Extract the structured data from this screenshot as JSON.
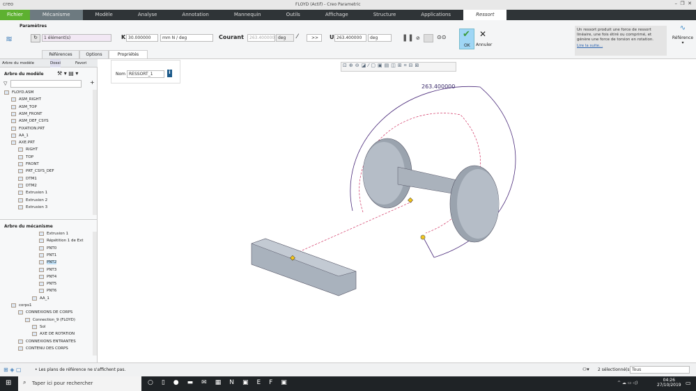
{
  "app": {
    "logo": "creo",
    "title": "FLOYD (Actif) - Creo Parametric"
  },
  "tabs": [
    "Fichier",
    "Mécanisme",
    "Modèle",
    "Analyse",
    "Annotation",
    "Mannequin",
    "Outils",
    "Affichage",
    "Structure",
    "Applications",
    "Ressort"
  ],
  "ribbon": {
    "group_label": "Paramètres",
    "references": "1 élément(s)",
    "k_label": "K",
    "k_value": "30.000000",
    "k_unit": "mm N / deg",
    "courant_label": "Courant",
    "courant_value": "263.400000",
    "courant_unit": "deg",
    "arrow_btn": ">>",
    "u_label": "U",
    "u_value": "263.400000",
    "u_unit": "deg",
    "ok": "OK",
    "cancel": "Annuler",
    "help_text": "Un ressort produit une force de ressort linéaire, une fois étiré ou comprimé, et génère une force de torsion en rotation.",
    "help_link": "Lire la suite...",
    "reference": "Référence",
    "subtabs": [
      "Références",
      "Options",
      "Propriétés"
    ],
    "accent": "#5db130"
  },
  "properties": {
    "name_label": "Nom",
    "name_value": "RESSORT_1"
  },
  "left": {
    "tabs": [
      "Arbre du modèle",
      "Dossi",
      "Favori"
    ],
    "model_tree_title": "Arbre du modèle",
    "model_tree": [
      {
        "label": "FLOYD.ASM",
        "l": 0
      },
      {
        "label": "ASM_RIGHT",
        "l": 1
      },
      {
        "label": "ASM_TOP",
        "l": 1
      },
      {
        "label": "ASM_FRONT",
        "l": 1
      },
      {
        "label": "ASM_DEF_CSYS",
        "l": 1
      },
      {
        "label": "FIXATION.PRT",
        "l": 1
      },
      {
        "label": "AA_1",
        "l": 1
      },
      {
        "label": "AXE.PRT",
        "l": 1
      },
      {
        "label": "RIGHT",
        "l": 2
      },
      {
        "label": "TOP",
        "l": 2
      },
      {
        "label": "FRONT",
        "l": 2
      },
      {
        "label": "PRT_CSYS_DEF",
        "l": 2
      },
      {
        "label": "DTM1",
        "l": 2
      },
      {
        "label": "DTM2",
        "l": 2
      },
      {
        "label": "Extrusion 1",
        "l": 2
      },
      {
        "label": "Extrusion 2",
        "l": 2
      },
      {
        "label": "Extrusion 3",
        "l": 2
      }
    ],
    "mech_tree_title": "Arbre du mécanisme",
    "mech_tree": [
      {
        "label": "Extrusion 1",
        "l": 5
      },
      {
        "label": "Répétition 1 de Ext",
        "l": 5
      },
      {
        "label": "PNT0",
        "l": 5
      },
      {
        "label": "PNT1",
        "l": 5
      },
      {
        "label": "PNT2",
        "l": 5,
        "selected": true
      },
      {
        "label": "PNT3",
        "l": 5
      },
      {
        "label": "PNT4",
        "l": 5
      },
      {
        "label": "PNT5",
        "l": 5
      },
      {
        "label": "PNT6",
        "l": 5
      },
      {
        "label": "AA_1",
        "l": 4
      },
      {
        "label": "corps1",
        "l": 1
      },
      {
        "label": "CONNEXIONS DE CORPS",
        "l": 2
      },
      {
        "label": "Connection_9 (FLOYD)",
        "l": 3
      },
      {
        "label": "Sol",
        "l": 4
      },
      {
        "label": "AXE DE ROTATION",
        "l": 4
      },
      {
        "label": "CONNEXIONS ENTRANTES",
        "l": 2
      },
      {
        "label": "CONTENU DES CORPS",
        "l": 2
      }
    ]
  },
  "viewport": {
    "dimension": "263.400000"
  },
  "status": {
    "message": "• Les plans de référence ne s'affichent pas.",
    "selected": "2 sélectionné(s)",
    "filter": "Tous"
  },
  "taskbar": {
    "search": "Taper ici pour rechercher",
    "time": "04:26",
    "date": "27/10/2019"
  }
}
